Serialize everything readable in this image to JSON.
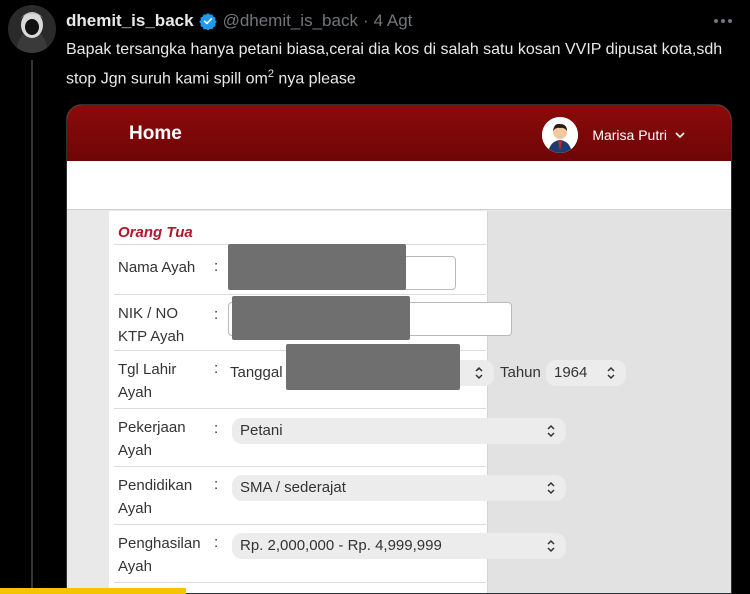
{
  "tweet": {
    "display_name": "dhemit_is_back",
    "handle": "@dhemit_is_back",
    "separator": "·",
    "date": "4 Agt",
    "text_main": "Bapak tersangka hanya petani biasa,cerai dia kos di salah satu kosan VVIP dipusat kota,sdh stop Jgn suruh kami spill om",
    "text_sup": "2",
    "text_tail": " nya please"
  },
  "app": {
    "home_label": "Home",
    "user_name": "Marisa Putri",
    "user_menu_icon": "chevron-down"
  },
  "form": {
    "section_title": "Orang Tua",
    "colon": ":",
    "fields": {
      "nama_ayah": {
        "label": "Nama Ayah"
      },
      "nik": {
        "label_line1": "NIK / NO",
        "label_line2": "KTP Ayah"
      },
      "tgl_lahir": {
        "label_line1": "Tgl Lahir",
        "label_line2": "Ayah",
        "day_label": "Tanggal",
        "year_label": "Tahun",
        "year_value": "1964"
      },
      "pekerjaan": {
        "label_line1": "Pekerjaan",
        "label_line2": "Ayah",
        "value": "Petani"
      },
      "pendidikan": {
        "label_line1": "Pendidikan",
        "label_line2": "Ayah",
        "value": "SMA / sederajat"
      },
      "penghasilan": {
        "label_line1": "Penghasilan",
        "label_line2": "Ayah",
        "value": "Rp. 2,000,000 - Rp. 4,999,999"
      }
    }
  },
  "colors": {
    "header_red": "#7a0808",
    "section_red": "#b0172a",
    "verified_blue": "#1d9bf0",
    "redaction_gray": "#6f6f6f"
  }
}
